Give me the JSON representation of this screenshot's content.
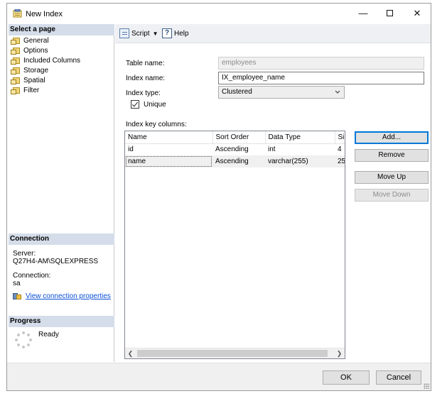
{
  "window": {
    "title": "New Index"
  },
  "select_page": {
    "header": "Select a page",
    "items": [
      {
        "label": "General"
      },
      {
        "label": "Options"
      },
      {
        "label": "Included Columns"
      },
      {
        "label": "Storage"
      },
      {
        "label": "Spatial"
      },
      {
        "label": "Filter"
      }
    ]
  },
  "connection": {
    "header": "Connection",
    "server_label": "Server:",
    "server_value": "Q27H4-AM\\SQLEXPRESS",
    "connection_label": "Connection:",
    "connection_value": "sa",
    "link_label": "View connection properties"
  },
  "progress": {
    "header": "Progress",
    "status": "Ready"
  },
  "toolbar": {
    "script_label": "Script",
    "help_label": "Help"
  },
  "form": {
    "table_name_label": "Table name:",
    "table_name_value": "employees",
    "index_name_label": "Index name:",
    "index_name_value": "IX_employee_name",
    "index_type_label": "Index type:",
    "index_type_value": "Clustered",
    "unique_label": "Unique",
    "unique_checked": true,
    "key_columns_label": "Index key columns:"
  },
  "grid": {
    "headers": [
      "Name",
      "Sort Order",
      "Data Type",
      "Si"
    ],
    "rows": [
      {
        "name": "id",
        "sort_order": "Ascending",
        "data_type": "int",
        "size": "4"
      },
      {
        "name": "name",
        "sort_order": "Ascending",
        "data_type": "varchar(255)",
        "size": "25"
      }
    ]
  },
  "side_buttons": {
    "add": "Add...",
    "remove": "Remove",
    "move_up": "Move Up",
    "move_down": "Move Down"
  },
  "footer": {
    "ok": "OK",
    "cancel": "Cancel"
  },
  "colors": {
    "section_header_bg": "#d4dde9",
    "link": "#0b4fd6",
    "default_button_border": "#0078d7"
  }
}
